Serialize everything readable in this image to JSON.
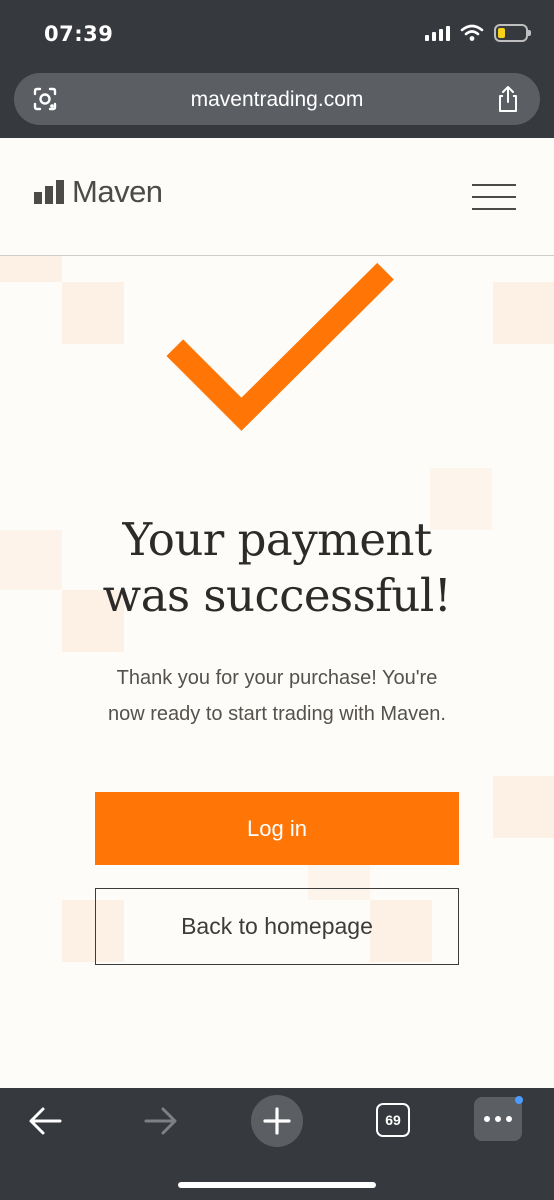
{
  "status_bar": {
    "time": "07:39",
    "battery_level_fraction": 0.25,
    "icons": [
      "cellular-signal-icon",
      "wifi-icon",
      "battery-icon"
    ]
  },
  "browser": {
    "url": "maventrading.com",
    "tabs_count": "69",
    "icons": [
      "lens-icon",
      "share-icon",
      "back-arrow-icon",
      "forward-arrow-icon",
      "plus-icon",
      "tabs-icon",
      "more-icon"
    ]
  },
  "header": {
    "logo_text": "Maven",
    "logo_icon": "bar-chart-logo-icon",
    "menu_icon": "hamburger-menu-icon"
  },
  "main": {
    "success_icon": "checkmark-icon",
    "heading_line1": "Your payment",
    "heading_line2": "was successful!",
    "message_line1": "Thank you for your purchase! You're",
    "message_line2": "now ready to start trading with Maven.",
    "login_label": "Log in",
    "home_label": "Back to homepage"
  },
  "colors": {
    "accent": "#ff7606",
    "page_background": "#fdfcf8",
    "browser_chrome": "#36393d",
    "text_dark": "#2d2b2a"
  }
}
